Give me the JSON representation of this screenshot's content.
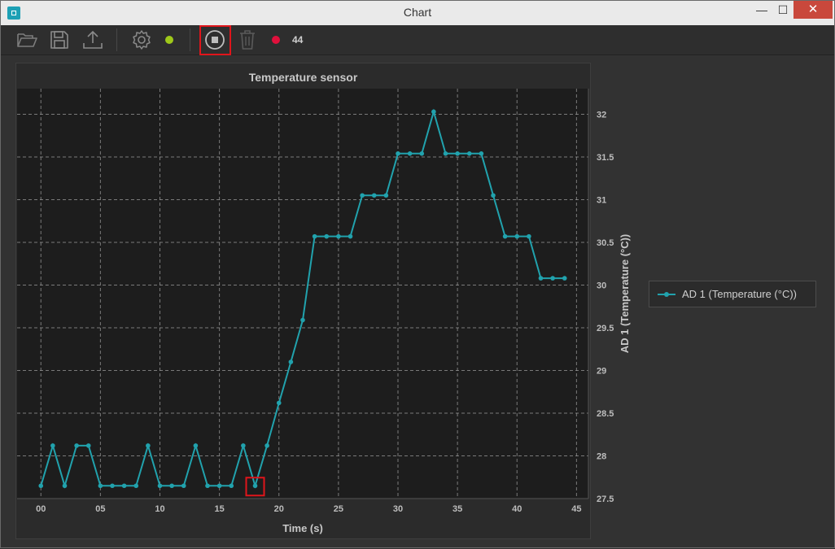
{
  "window": {
    "title": "Chart",
    "minimize_glyph": "—",
    "maximize_glyph": "☐",
    "close_glyph": "✕"
  },
  "toolbar": {
    "icons": [
      "open-folder-icon",
      "save-icon",
      "export-icon",
      "settings-icon",
      "stop-icon",
      "trash-icon"
    ],
    "connection_status_color": "#9fc91a",
    "recording_status_color": "#e0103c",
    "sample_count": "44"
  },
  "colors": {
    "series": "#21a2ad",
    "highlight": "#e0151b"
  },
  "legend": {
    "label": "AD 1 (Temperature (°C))"
  },
  "chart_data": {
    "type": "line",
    "title": "Temperature sensor",
    "xlabel": "Time (s)",
    "ylabel": "AD 1 (Temperature (°C))",
    "xlim": [
      -2,
      46
    ],
    "ylim": [
      27.5,
      32.3
    ],
    "x_ticks": [
      0,
      5,
      10,
      15,
      20,
      25,
      30,
      35,
      40,
      45
    ],
    "x_tick_labels": [
      "00",
      "05",
      "10",
      "15",
      "20",
      "25",
      "30",
      "35",
      "40",
      "45"
    ],
    "y_ticks": [
      27.5,
      28,
      28.5,
      29,
      29.5,
      30,
      30.5,
      31,
      31.5,
      32
    ],
    "y_tick_labels": [
      "27.5",
      "28",
      "28.5",
      "29",
      "29.5",
      "30",
      "30.5",
      "31",
      "31.5",
      "32"
    ],
    "grid": true,
    "legend_position": "right",
    "highlighted_x": 18,
    "series": [
      {
        "name": "AD 1 (Temperature (°C))",
        "x": [
          0,
          1,
          2,
          3,
          4,
          5,
          6,
          7,
          8,
          9,
          10,
          11,
          12,
          13,
          14,
          15,
          16,
          17,
          18,
          19,
          20,
          21,
          22,
          23,
          24,
          25,
          26,
          27,
          28,
          29,
          30,
          31,
          32,
          33,
          34,
          35,
          36,
          37,
          38,
          39,
          40,
          41,
          42,
          43,
          44
        ],
        "y": [
          27.65,
          28.12,
          27.65,
          28.12,
          28.12,
          27.65,
          27.65,
          27.65,
          27.65,
          28.12,
          27.65,
          27.65,
          27.65,
          28.12,
          27.65,
          27.65,
          27.65,
          28.12,
          27.65,
          28.12,
          28.62,
          29.1,
          29.59,
          30.57,
          30.57,
          30.57,
          30.57,
          31.05,
          31.05,
          31.05,
          31.54,
          31.54,
          31.54,
          32.03,
          31.54,
          31.54,
          31.54,
          31.54,
          31.05,
          30.57,
          30.57,
          30.57,
          30.08,
          30.08,
          30.08
        ]
      }
    ]
  }
}
